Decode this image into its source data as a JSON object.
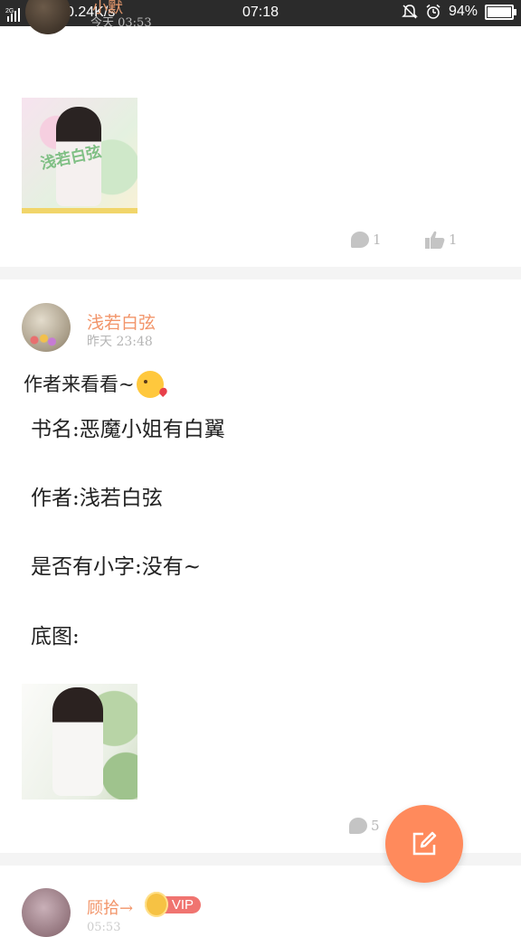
{
  "status_bar": {
    "network_speed": "0.24K/s",
    "time": "07:18",
    "battery_percent": "94%",
    "battery_level": 0.94
  },
  "previous_post": {
    "author": "小默",
    "time": "今天 03:53",
    "comment_count": "1",
    "like_count": "1"
  },
  "post": {
    "author": "浅若白弦",
    "time": "昨天 23:48",
    "intro": "作者来看看~",
    "lines": [
      "书名:恶魔小姐有白翼",
      "作者:浅若白弦",
      "是否有小字:没有~",
      "底图:"
    ],
    "comment_count": "5"
  },
  "next_post": {
    "author": "顾拾→",
    "vip_label": "VIP",
    "time": "05:53"
  },
  "colors": {
    "accent": "#f2956a",
    "fab": "#ff8a5c",
    "vip": "#f07470"
  }
}
